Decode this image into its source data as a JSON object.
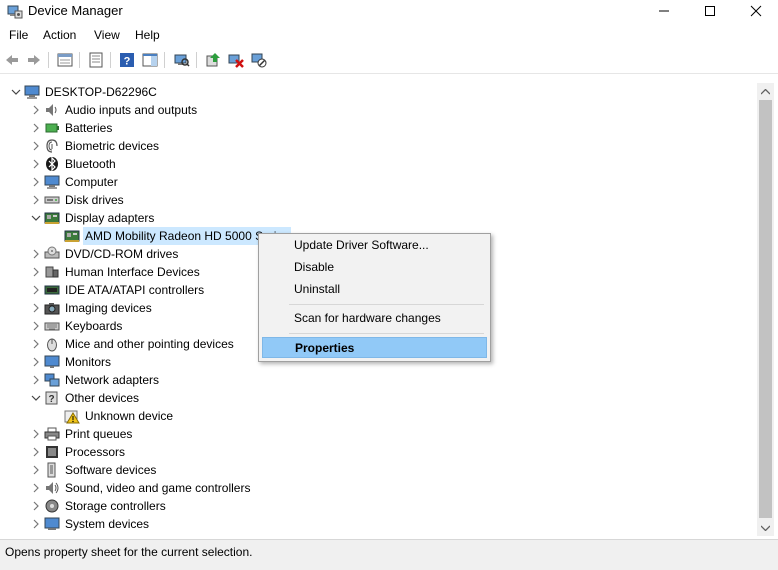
{
  "window": {
    "title": "Device Manager"
  },
  "menu": [
    "File",
    "Action",
    "View",
    "Help"
  ],
  "toolbar_icons": [
    "back-icon",
    "forward-icon",
    "properties-pane-icon",
    "view-icon",
    "help-icon",
    "action-pane-icon",
    "scan-hardware-icon",
    "update-driver-icon",
    "uninstall-device-icon",
    "disable-device-icon"
  ],
  "tree": {
    "root": "DESKTOP-D62296C",
    "items": [
      {
        "label": "Audio inputs and outputs",
        "icon": "audio-icon",
        "expanded": false
      },
      {
        "label": "Batteries",
        "icon": "battery-icon",
        "expanded": false
      },
      {
        "label": "Biometric devices",
        "icon": "biometric-icon",
        "expanded": false
      },
      {
        "label": "Bluetooth",
        "icon": "bluetooth-icon",
        "expanded": false
      },
      {
        "label": "Computer",
        "icon": "computer-icon",
        "expanded": false
      },
      {
        "label": "Disk drives",
        "icon": "disk-drive-icon",
        "expanded": false
      },
      {
        "label": "Display adapters",
        "icon": "display-adapter-icon",
        "expanded": true
      },
      {
        "label": "AMD Mobility Radeon HD 5000 Series",
        "icon": "gpu-icon",
        "child": true,
        "selected": true
      },
      {
        "label": "DVD/CD-ROM drives",
        "icon": "dvd-icon",
        "expanded": false
      },
      {
        "label": "Human Interface Devices",
        "icon": "hid-icon",
        "expanded": false
      },
      {
        "label": "IDE ATA/ATAPI controllers",
        "icon": "ide-icon",
        "expanded": false
      },
      {
        "label": "Imaging devices",
        "icon": "camera-icon",
        "expanded": false
      },
      {
        "label": "Keyboards",
        "icon": "keyboard-icon",
        "expanded": false
      },
      {
        "label": "Mice and other pointing devices",
        "icon": "mouse-icon",
        "expanded": false
      },
      {
        "label": "Monitors",
        "icon": "monitor-icon",
        "expanded": false
      },
      {
        "label": "Network adapters",
        "icon": "network-icon",
        "expanded": false
      },
      {
        "label": "Other devices",
        "icon": "other-devices-icon",
        "expanded": true
      },
      {
        "label": "Unknown device",
        "icon": "warning-icon",
        "child": true
      },
      {
        "label": "Print queues",
        "icon": "printer-icon",
        "expanded": false
      },
      {
        "label": "Processors",
        "icon": "processor-icon",
        "expanded": false
      },
      {
        "label": "Software devices",
        "icon": "software-device-icon",
        "expanded": false
      },
      {
        "label": "Sound, video and game controllers",
        "icon": "sound-icon",
        "expanded": false
      },
      {
        "label": "Storage controllers",
        "icon": "storage-icon",
        "expanded": false
      },
      {
        "label": "System devices",
        "icon": "system-icon",
        "expanded": false
      }
    ]
  },
  "context_menu": {
    "items": [
      "Update Driver Software...",
      "Disable",
      "Uninstall",
      "Scan for hardware changes",
      "Properties"
    ],
    "highlighted": "Properties"
  },
  "status": "Opens property sheet for the current selection.",
  "colors": {
    "selection": "#cce8ff",
    "menu_highlight": "#91c9f7"
  }
}
